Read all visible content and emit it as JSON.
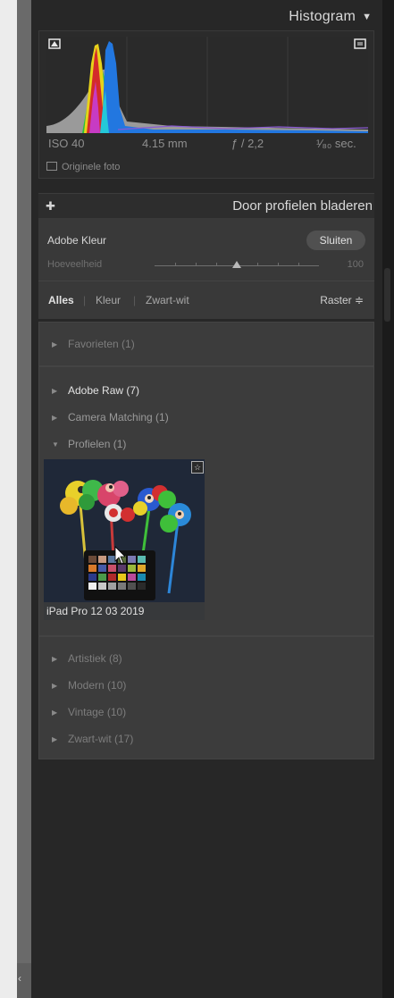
{
  "histogram": {
    "title": "Histogram",
    "iso": "ISO 40",
    "focal_length": "4.15 mm",
    "aperture": "ƒ / 2,2",
    "shutter": "¹⁄₈₀ sec.",
    "original_photo_label": "Originele foto"
  },
  "profile_browser": {
    "title": "Door profielen bladeren",
    "current_profile": "Adobe Kleur",
    "close_label": "Sluiten",
    "amount_label": "Hoeveelheid",
    "amount_value": "100",
    "amount_fraction": 0.5
  },
  "filters": {
    "all": "Alles",
    "color": "Kleur",
    "bw": "Zwart-wit",
    "view": "Raster ≑"
  },
  "groups": {
    "favorites": "Favorieten (1)",
    "adobe_raw": "Adobe Raw (7)",
    "camera_matching": "Camera Matching (1)",
    "profiles": "Profielen (1)",
    "artistic": "Artistiek (8)",
    "modern": "Modern (10)",
    "vintage": "Vintage (10)",
    "bw": "Zwart-wit (17)"
  },
  "thumbnail": {
    "caption": "iPad Pro 12 03 2019"
  },
  "icons": {
    "collapse": "triangle-down-icon",
    "add": "plus-icon",
    "favorite": "star-icon",
    "cursor": "pointer-cursor-icon"
  }
}
